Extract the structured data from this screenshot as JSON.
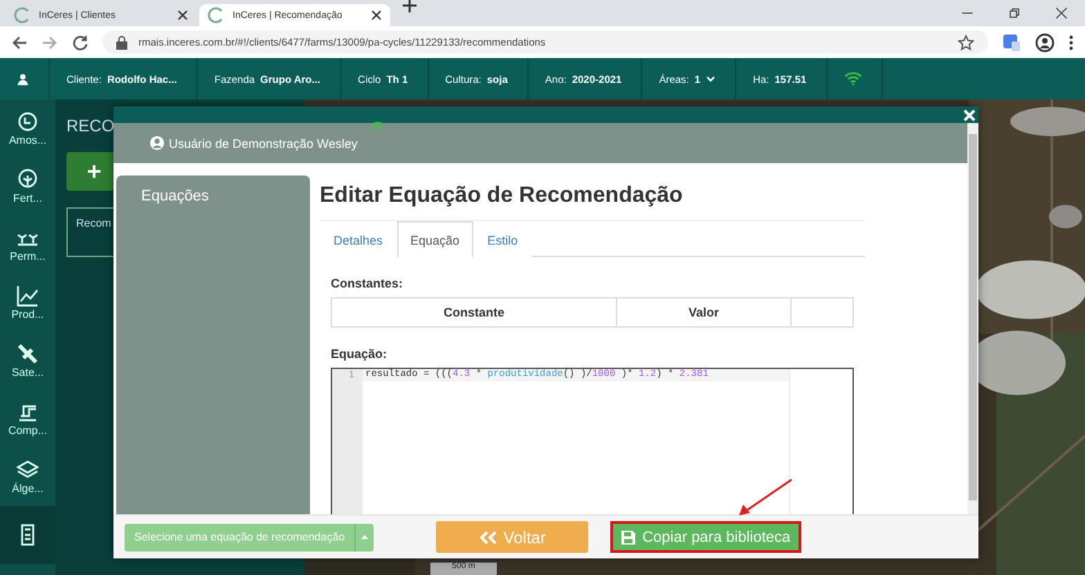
{
  "browser": {
    "tabs": [
      {
        "title": "InCeres | Clientes",
        "selected": false
      },
      {
        "title": "InCeres | Recomendação",
        "selected": true
      }
    ],
    "url": "rmais.inceres.com.br/#!/clients/6477/farms/13009/pa-cycles/11229133/recommendations"
  },
  "breadcrumb": [
    {
      "label": "Cliente:",
      "value": "Rodolfo Hac..."
    },
    {
      "label": "Fazenda",
      "value": "Grupo Aro..."
    },
    {
      "label": "Ciclo",
      "value": "Th 1"
    },
    {
      "label": "Cultura:",
      "value": "soja"
    },
    {
      "label": "Ano:",
      "value": "2020-2021"
    },
    {
      "label": "Áreas:",
      "value": "1",
      "dropdown": true
    },
    {
      "label": "Ha:",
      "value": "157.51"
    }
  ],
  "sidebar": [
    {
      "label": "Amos...",
      "selected": false
    },
    {
      "label": "Fert...",
      "selected": false
    },
    {
      "label": "Perm...",
      "selected": false
    },
    {
      "label": "Prod...",
      "selected": false
    },
    {
      "label": "Sate...",
      "selected": false
    },
    {
      "label": "Comp...",
      "selected": false
    },
    {
      "label": "Álge...",
      "selected": false
    },
    {
      "selected": true
    }
  ],
  "panel": {
    "title": "RECO",
    "add_button": "+",
    "card": "Recom"
  },
  "scale": "500 m",
  "modal": {
    "user": "Usuário de Demonstração Wesley",
    "side_title": "Equações",
    "title": "Editar Equação de Recomendação",
    "tabs": [
      {
        "label": "Detalhes",
        "selected": false
      },
      {
        "label": "Equação",
        "selected": true
      },
      {
        "label": "Estilo",
        "selected": false
      }
    ],
    "constants_label": "Constantes:",
    "columns": [
      "Constante",
      "Valor"
    ],
    "equation_label": "Equação:",
    "line_number": "1",
    "code": [
      {
        "kind": "text",
        "text": "resultado = ((("
      },
      {
        "kind": "number",
        "text": "4.3"
      },
      {
        "kind": "text",
        "text": " * "
      },
      {
        "kind": "function",
        "text": "produtividade"
      },
      {
        "kind": "text",
        "text": "() )/"
      },
      {
        "kind": "number",
        "text": "1000"
      },
      {
        "kind": "text",
        "text": " )* "
      },
      {
        "kind": "number",
        "text": "1.2"
      },
      {
        "kind": "text",
        "text": ") * "
      },
      {
        "kind": "number",
        "text": "2.381"
      }
    ],
    "select_button": "Selecione uma equação de recomendação",
    "back_button": "Voltar",
    "copy_button": "Copiar para biblioteca"
  }
}
